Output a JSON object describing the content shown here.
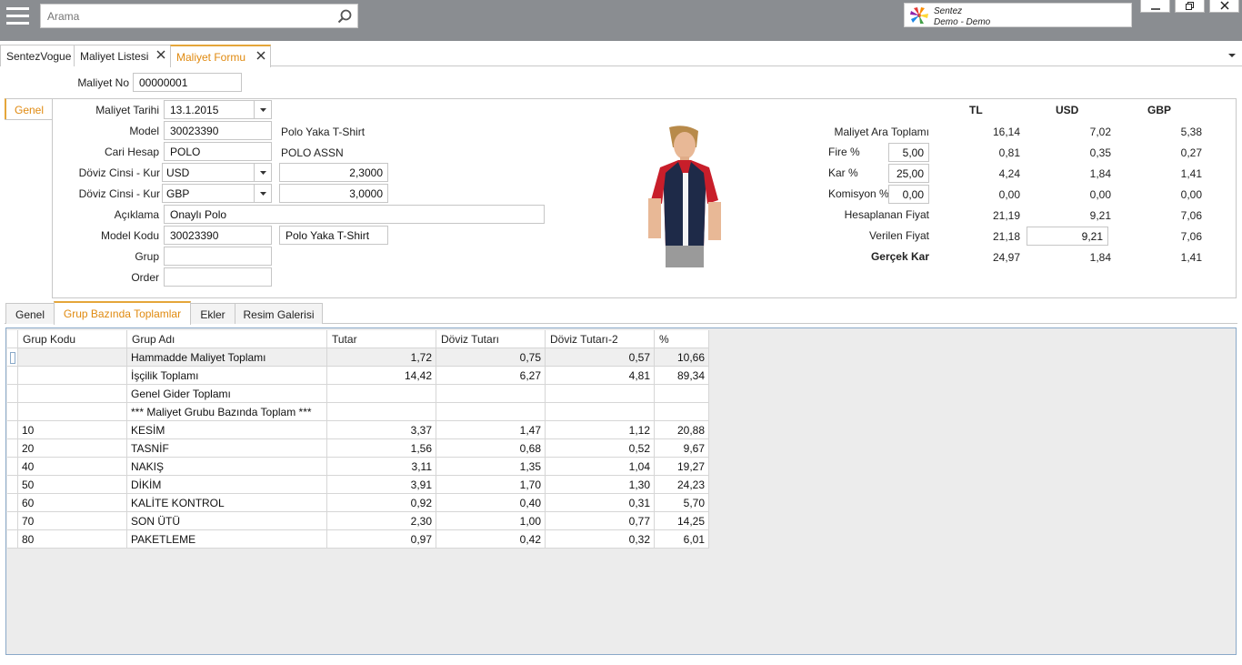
{
  "search": {
    "placeholder": "Arama"
  },
  "brand": {
    "name": "Sentez",
    "subtitle": "Demo - Demo"
  },
  "doc_tabs": [
    {
      "label": "SentezVogue"
    },
    {
      "label": "Maliyet Listesi"
    },
    {
      "label": "Maliyet Formu"
    }
  ],
  "form": {
    "maliyet_no_label": "Maliyet No",
    "maliyet_no": "00000001",
    "side_tab": "Genel",
    "maliyet_tarihi_label": "Maliyet Tarihi",
    "maliyet_tarihi": "13.1.2015",
    "model_label": "Model",
    "model": "30023390",
    "model_desc": "Polo Yaka T-Shirt",
    "cari_hesap_label": "Cari Hesap",
    "cari_hesap": "POLO",
    "cari_hesap_desc": "POLO ASSN",
    "doviz1_label": "Döviz Cinsi - Kur",
    "doviz1": "USD",
    "doviz1_rate": "2,3000",
    "doviz2_label": "Döviz Cinsi - Kur",
    "doviz2": "GBP",
    "doviz2_rate": "3,0000",
    "aciklama_label": "Açıklama",
    "aciklama": "Onaylı Polo",
    "model_kodu_label": "Model Kodu",
    "model_kodu": "30023390",
    "model_kodu_desc": "Polo Yaka T-Shirt",
    "grup_label": "Grup",
    "grup": "",
    "order_label": "Order",
    "order": ""
  },
  "summary": {
    "col_tl": "TL",
    "col_usd": "USD",
    "col_gbp": "GBP",
    "ara_toplam_label": "Maliyet Ara Toplamı",
    "ara_toplam": [
      "16,14",
      "7,02",
      "5,38"
    ],
    "fire_label": "Fire %",
    "fire_pct": "5,00",
    "fire": [
      "0,81",
      "0,35",
      "0,27"
    ],
    "kar_label": "Kar %",
    "kar_pct": "25,00",
    "kar": [
      "4,24",
      "1,84",
      "1,41"
    ],
    "komisyon_label": "Komisyon %",
    "komisyon_pct": "0,00",
    "komisyon": [
      "0,00",
      "0,00",
      "0,00"
    ],
    "hesaplanan_label": "Hesaplanan Fiyat",
    "hesaplanan": [
      "21,19",
      "9,21",
      "7,06"
    ],
    "verilen_label": "Verilen Fiyat",
    "verilen": [
      "21,18",
      "9,21",
      "7,06"
    ],
    "gercek_kar_label": "Gerçek Kar",
    "gercek_kar": [
      "24,97",
      "1,84",
      "1,41"
    ]
  },
  "bottom_tabs": [
    {
      "label": "Genel"
    },
    {
      "label": "Grup Bazında Toplamlar"
    },
    {
      "label": "Ekler"
    },
    {
      "label": "Resim Galerisi"
    }
  ],
  "grid": {
    "columns": [
      "Grup Kodu",
      "Grup Adı",
      "Tutar",
      "Döviz Tutarı",
      "Döviz Tutarı-2",
      "%"
    ],
    "rows": [
      [
        "",
        "Hammadde Maliyet Toplamı",
        "1,72",
        "0,75",
        "0,57",
        "10,66"
      ],
      [
        "",
        "İşçilik Toplamı",
        "14,42",
        "6,27",
        "4,81",
        "89,34"
      ],
      [
        "",
        "Genel Gider Toplamı",
        "",
        "",
        "",
        ""
      ],
      [
        "",
        "*** Maliyet Grubu Bazında Toplam ***",
        "",
        "",
        "",
        ""
      ],
      [
        "10",
        "KESİM",
        "3,37",
        "1,47",
        "1,12",
        "20,88"
      ],
      [
        "20",
        "TASNİF",
        "1,56",
        "0,68",
        "0,52",
        "9,67"
      ],
      [
        "40",
        "NAKIŞ",
        "3,11",
        "1,35",
        "1,04",
        "19,27"
      ],
      [
        "50",
        "DİKİM",
        "3,91",
        "1,70",
        "1,30",
        "24,23"
      ],
      [
        "60",
        "KALİTE KONTROL",
        "0,92",
        "0,40",
        "0,31",
        "5,70"
      ],
      [
        "70",
        "SON ÜTÜ",
        "2,30",
        "1,00",
        "0,77",
        "14,25"
      ],
      [
        "80",
        "PAKETLEME",
        "0,97",
        "0,42",
        "0,32",
        "6,01"
      ]
    ]
  },
  "colors": {
    "topbar": "#8a8d91",
    "accent": "#e08a10",
    "grid_border": "#8aa9c8"
  }
}
